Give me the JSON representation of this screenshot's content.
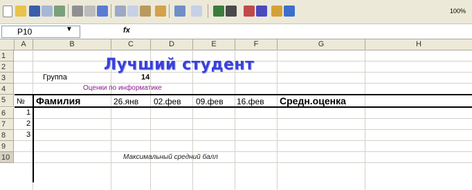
{
  "toolbar": {
    "zoom": "100%"
  },
  "formula_bar": {
    "name_box": "P10",
    "fx_label": "fx"
  },
  "columns": [
    "A",
    "B",
    "C",
    "D",
    "E",
    "F",
    "G",
    "H"
  ],
  "rows": [
    "1",
    "2",
    "3",
    "4",
    "5",
    "6",
    "7",
    "8",
    "9",
    "10"
  ],
  "sheet": {
    "title": "Лучший студент",
    "group_label": "Группа",
    "group_value": "14",
    "grades_caption": "Оценки по информатике",
    "headers": {
      "no": "№",
      "surname": "Фамилия",
      "d1": "26.янв",
      "d2": "02.фев",
      "d3": "09.фев",
      "d4": "16.фев",
      "avg": "Средн.оценка"
    },
    "row_numbers": [
      "1",
      "2",
      "3"
    ],
    "max_avg": "Максимальный средний балл"
  }
}
